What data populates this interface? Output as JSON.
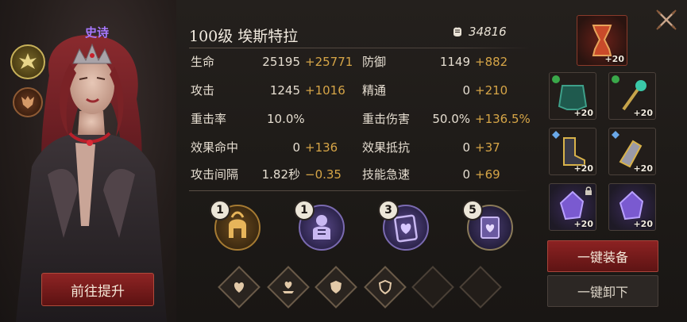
{
  "hero": {
    "rarity": "史诗",
    "promote_label": "前往提升",
    "title": "100级  埃斯特拉",
    "power": "34816"
  },
  "stats": [
    {
      "label": "生命",
      "value": "25195",
      "bonus": "+25771"
    },
    {
      "label": "防御",
      "value": "1149",
      "bonus": "+882"
    },
    {
      "label": "攻击",
      "value": "1245",
      "bonus": "+1016"
    },
    {
      "label": "精通",
      "value": "0",
      "bonus": "+210"
    },
    {
      "label": "重击率",
      "value": "10.0%",
      "bonus": ""
    },
    {
      "label": "重击伤害",
      "value": "50.0%",
      "bonus": "+136.5%"
    },
    {
      "label": "效果命中",
      "value": "0",
      "bonus": "+136"
    },
    {
      "label": "效果抵抗",
      "value": "0",
      "bonus": "+37"
    },
    {
      "label": "攻击间隔",
      "value": "1.82秒",
      "bonus": "−0.35"
    },
    {
      "label": "技能急速",
      "value": "0",
      "bonus": "+69"
    }
  ],
  "medallions": [
    {
      "level": "1",
      "icon": "spartan-helmet-icon"
    },
    {
      "level": "1",
      "icon": "armored-knight-icon"
    },
    {
      "level": "3",
      "icon": "heart-card-icon"
    },
    {
      "level": "5",
      "icon": "heart-tome-icon"
    }
  ],
  "slots": [
    "heart-icon",
    "heart-hand-icon",
    "shield-heart-icon",
    "shield-icon",
    "empty",
    "empty"
  ],
  "equipment": [
    {
      "name": "hourglass-relic-icon",
      "level": "+20"
    },
    {
      "name": "armor-chest-icon",
      "level": "+20"
    },
    {
      "name": "staff-icon",
      "level": "+20"
    },
    {
      "name": "gold-boots-icon",
      "level": "+20"
    },
    {
      "name": "gold-gauntlet-icon",
      "level": "+20"
    },
    {
      "name": "purple-crystal-icon",
      "level": "+20"
    },
    {
      "name": "purple-crystal-icon",
      "level": "+20"
    }
  ],
  "actions": {
    "equip_all": "一键装备",
    "unequip_all": "一键卸下"
  },
  "colors": {
    "bonus": "#d6a547",
    "rarity": "#a878ff",
    "accent_red": "#8c2222"
  }
}
